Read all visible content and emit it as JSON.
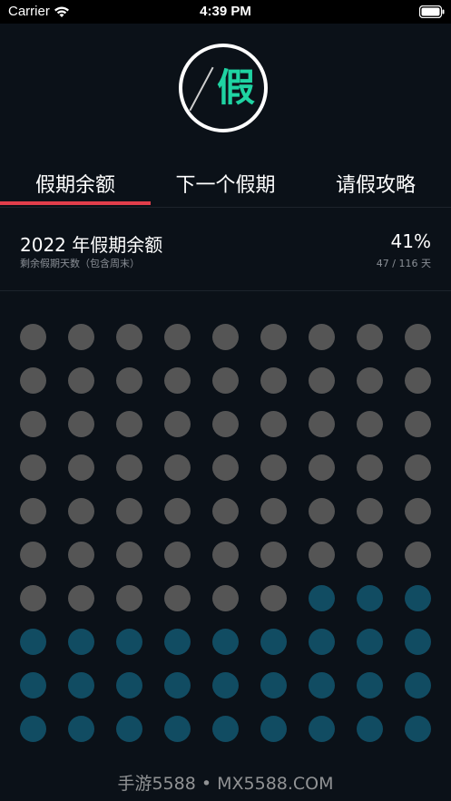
{
  "status_bar": {
    "carrier": "Carrier",
    "time": "4:39 PM",
    "wifi_icon": "wifi-icon",
    "battery_icon": "battery-icon"
  },
  "logo": {
    "character": "假",
    "color": "#1fd3a2"
  },
  "tabs": [
    {
      "label": "假期余额",
      "active": true
    },
    {
      "label": "下一个假期",
      "active": false
    },
    {
      "label": "请假攻略",
      "active": false
    }
  ],
  "accent_color": "#e23e4b",
  "summary": {
    "title": "2022 年假期余额",
    "subtitle": "剩余假期天数（包含周末）",
    "percent": "41%",
    "count": "47 / 116 天"
  },
  "grid": {
    "rows_visible": 10,
    "columns": 9,
    "used_color": "#555555",
    "remaining_color": "#114c62",
    "used_in_view": 60
  },
  "watermark": "手游5588 • MX5588.COM"
}
